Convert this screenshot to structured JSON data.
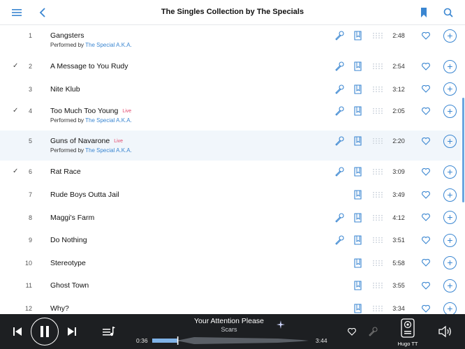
{
  "header": {
    "title": "The Singles Collection by The Specials",
    "menu_icon": "hamburger-menu-icon",
    "back_icon": "chevron-left-icon",
    "bookmark_icon": "bookmark-icon",
    "search_icon": "search-icon"
  },
  "colors": {
    "accent": "#3a86d1",
    "live": "#e2466b",
    "player_bg": "#1d1f22",
    "selected_row_bg": "#f1f6fb"
  },
  "tracks": [
    {
      "number": "1",
      "checked": false,
      "title": "Gangsters",
      "live": "",
      "performed_by_label": "Performed by",
      "performer": "The Special A.K.A.",
      "duration": "2:48",
      "mic": true,
      "book": true,
      "grid": true
    },
    {
      "number": "2",
      "checked": true,
      "title": "A Message to You Rudy",
      "live": "",
      "performed_by_label": "",
      "performer": "",
      "duration": "2:54",
      "mic": true,
      "book": true,
      "grid": true
    },
    {
      "number": "3",
      "checked": false,
      "title": "Nite Klub",
      "live": "",
      "performed_by_label": "",
      "performer": "",
      "duration": "3:12",
      "mic": true,
      "book": true,
      "grid": true
    },
    {
      "number": "4",
      "checked": true,
      "title": "Too Much Too Young",
      "live": "Live",
      "performed_by_label": "Performed by",
      "performer": "The Special A.K.A.",
      "duration": "2:05",
      "mic": true,
      "book": true,
      "grid": true
    },
    {
      "number": "5",
      "checked": false,
      "title": "Guns of Navarone",
      "live": "Live",
      "performed_by_label": "Performed by",
      "performer": "The Special A.K.A.",
      "duration": "2:20",
      "mic": true,
      "book": true,
      "grid": true,
      "selected": true
    },
    {
      "number": "6",
      "checked": true,
      "title": "Rat Race",
      "live": "",
      "performed_by_label": "",
      "performer": "",
      "duration": "3:09",
      "mic": true,
      "book": true,
      "grid": true
    },
    {
      "number": "7",
      "checked": false,
      "title": "Rude Boys Outta Jail",
      "live": "",
      "performed_by_label": "",
      "performer": "",
      "duration": "3:49",
      "mic": false,
      "book": true,
      "grid": true
    },
    {
      "number": "8",
      "checked": false,
      "title": "Maggi's Farm",
      "live": "",
      "performed_by_label": "",
      "performer": "",
      "duration": "4:12",
      "mic": true,
      "book": true,
      "grid": true
    },
    {
      "number": "9",
      "checked": false,
      "title": "Do Nothing",
      "live": "",
      "performed_by_label": "",
      "performer": "",
      "duration": "3:51",
      "mic": true,
      "book": true,
      "grid": true
    },
    {
      "number": "10",
      "checked": false,
      "title": "Stereotype",
      "live": "",
      "performed_by_label": "",
      "performer": "",
      "duration": "5:58",
      "mic": false,
      "book": true,
      "grid": true
    },
    {
      "number": "11",
      "checked": false,
      "title": "Ghost Town",
      "live": "",
      "performed_by_label": "",
      "performer": "",
      "duration": "3:55",
      "mic": false,
      "book": true,
      "grid": true
    },
    {
      "number": "12",
      "checked": false,
      "title": "Why?",
      "live": "",
      "performed_by_label": "",
      "performer": "",
      "duration": "3:34",
      "mic": false,
      "book": true,
      "grid": true
    }
  ],
  "player": {
    "now_playing_title": "Your Attention Please",
    "now_playing_artist": "Scars",
    "elapsed": "0:36",
    "total": "3:44",
    "progress_fraction": 0.16,
    "device_label": "Hugo TT"
  }
}
